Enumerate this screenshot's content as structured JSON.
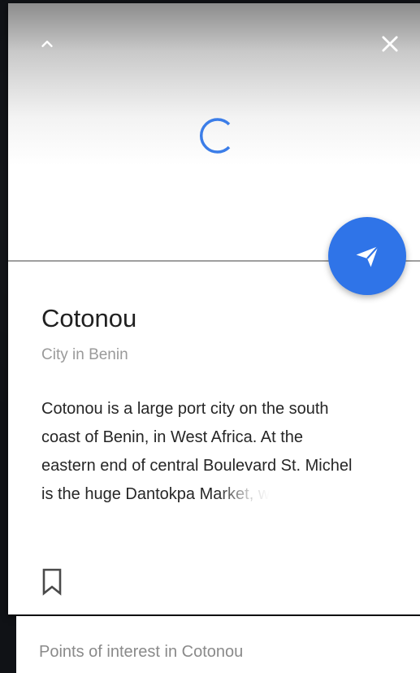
{
  "colors": {
    "accent": "#2f74e8",
    "title_text": "#202020",
    "secondary_text": "#9a9a9a",
    "body_text": "#262626"
  },
  "header": {
    "collapse_icon": "chevron-up-icon",
    "close_icon": "close-icon",
    "loading_icon": "loading-spinner-icon"
  },
  "fab": {
    "icon": "directions-send-icon"
  },
  "place": {
    "name": "Cotonou",
    "subtitle": "City in Benin",
    "description_lines": [
      "Cotonou is a large port city on the south",
      "coast of Benin, in West Africa. At the",
      "eastern end of central Boulevard St. Michel"
    ],
    "description_last_visible": "is the huge Dantokpa ",
    "description_last_faded": "Market, w"
  },
  "actions": {
    "bookmark_icon": "bookmark-icon"
  },
  "poi": {
    "title": "Points of interest in Cotonou"
  }
}
